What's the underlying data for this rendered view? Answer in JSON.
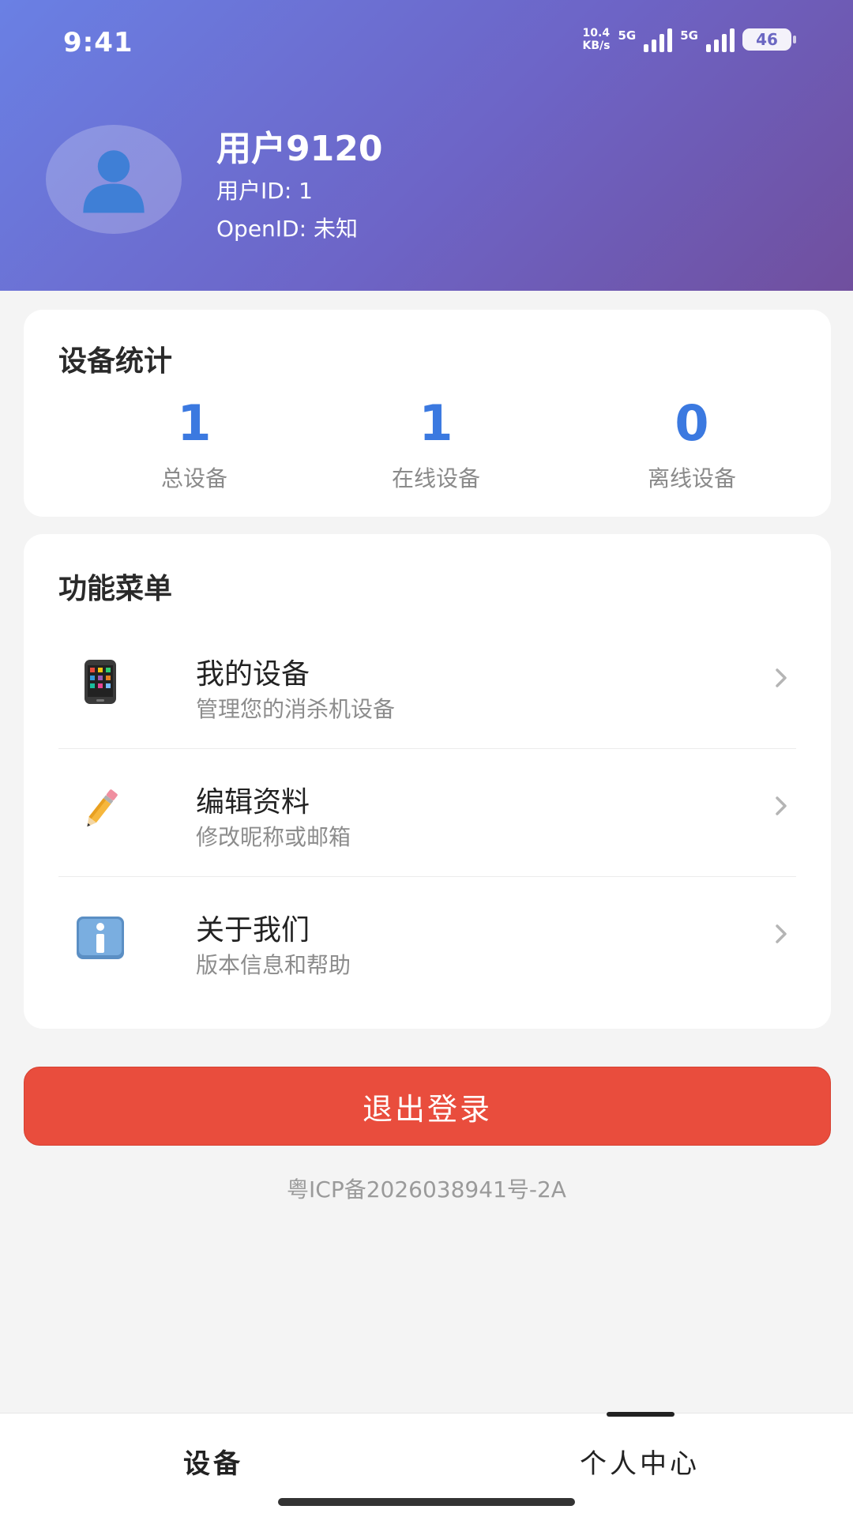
{
  "status_bar": {
    "time": "9:41",
    "net_speed_value": "10.4",
    "net_speed_unit": "KB/s",
    "sim1_label": "5G",
    "sim2_label": "5G",
    "battery": "46"
  },
  "profile": {
    "name": "用户9120",
    "user_id": "用户ID: 1",
    "open_id": "OpenID: 未知"
  },
  "stats": {
    "title": "设备统计",
    "items": [
      {
        "value": "1",
        "label": "总设备"
      },
      {
        "value": "1",
        "label": "在线设备"
      },
      {
        "value": "0",
        "label": "离线设备"
      }
    ]
  },
  "menu": {
    "title": "功能菜单",
    "items": [
      {
        "label": "我的设备",
        "desc": "管理您的消杀机设备",
        "icon": "mobile-phone-icon"
      },
      {
        "label": "编辑资料",
        "desc": "修改昵称或邮箱",
        "icon": "pencil-icon"
      },
      {
        "label": "关于我们",
        "desc": "版本信息和帮助",
        "icon": "info-icon"
      }
    ]
  },
  "logout_label": "退出登录",
  "icp": "粤ICP备2026038941号-2A",
  "tabs": [
    {
      "label": "设备",
      "active": false
    },
    {
      "label": "个人中心",
      "active": true
    }
  ],
  "colors": {
    "accent_blue": "#3b79e0",
    "logout_red": "#e94d3d",
    "header_gradient_start": "#6a80e4",
    "header_gradient_end": "#704f9e"
  }
}
